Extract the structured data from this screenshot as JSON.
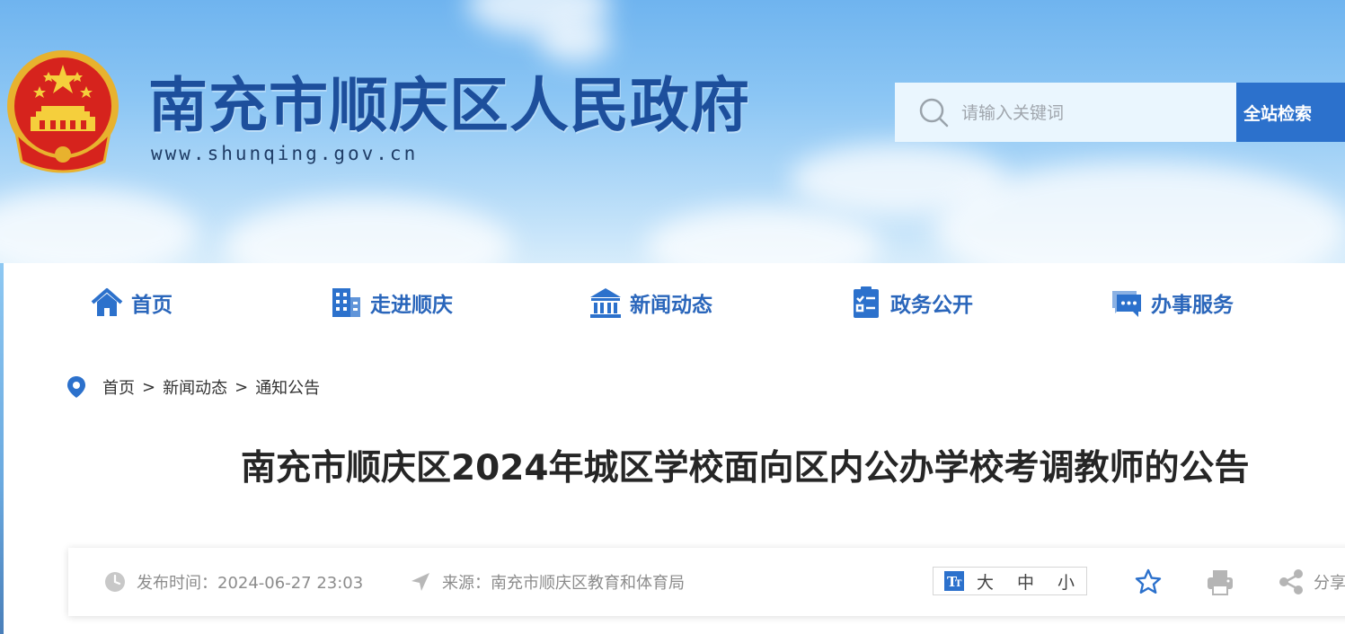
{
  "header": {
    "site_title": "南充市顺庆区人民政府",
    "site_url": "www.shunqing.gov.cn",
    "search": {
      "placeholder": "请输入关键词",
      "button_label": "全站检索"
    }
  },
  "nav": {
    "items": [
      {
        "label": "首页",
        "icon": "home-icon"
      },
      {
        "label": "走进顺庆",
        "icon": "building-icon"
      },
      {
        "label": "新闻动态",
        "icon": "government-building-icon"
      },
      {
        "label": "政务公开",
        "icon": "clipboard-checklist-icon"
      },
      {
        "label": "办事服务",
        "icon": "chat-service-icon"
      }
    ]
  },
  "breadcrumb": {
    "items": [
      "首页",
      "新闻动态",
      "通知公告"
    ],
    "separator": ">"
  },
  "article": {
    "title": "南充市顺庆区2024年城区学校面向区内公办学校考调教师的公告",
    "publish_label": "发布时间：2024-06-27 23:03",
    "source_label": "来源：南充市顺庆区教育和体育局",
    "font_size_options": [
      "大",
      "中",
      "小"
    ],
    "share_label": "分享"
  },
  "colors": {
    "brand_blue": "#2c71cc",
    "title_blue": "#1d4f9c",
    "nav_blue": "#2a66bb"
  }
}
